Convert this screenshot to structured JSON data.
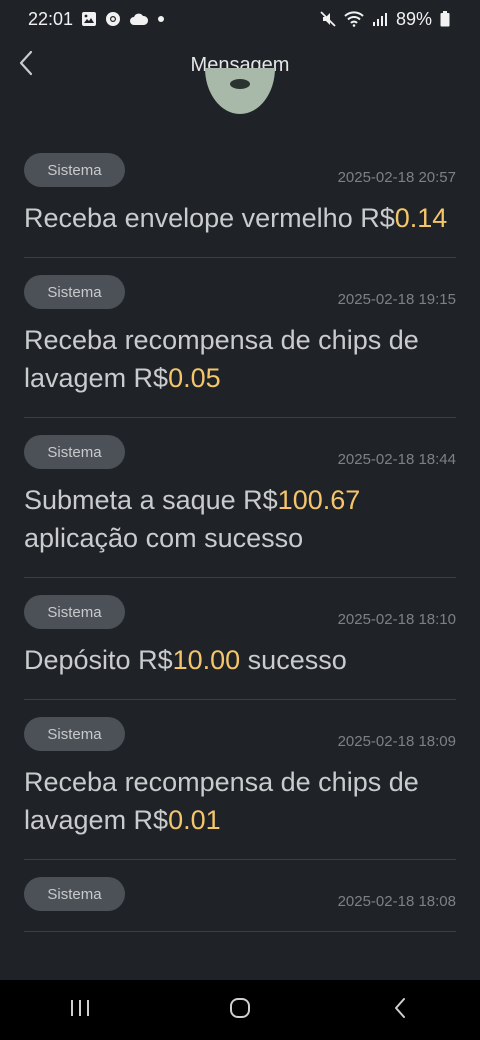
{
  "status_bar": {
    "time": "22:01",
    "battery": "89%"
  },
  "header": {
    "title": "Mensagem"
  },
  "messages": [
    {
      "badge": "Sistema",
      "time": "2025-02-18 20:57",
      "before": "Receba envelope vermelho R$",
      "amount": "0.14",
      "after": ""
    },
    {
      "badge": "Sistema",
      "time": "2025-02-18 19:15",
      "before": "Receba recompensa de chips de lavagem R$",
      "amount": "0.05",
      "after": ""
    },
    {
      "badge": "Sistema",
      "time": "2025-02-18 18:44",
      "before": "Submeta a saque R$",
      "amount": "100.67",
      "after": " aplicação com sucesso"
    },
    {
      "badge": "Sistema",
      "time": "2025-02-18 18:10",
      "before": "Depósito R$",
      "amount": "10.00",
      "after": " sucesso"
    },
    {
      "badge": "Sistema",
      "time": "2025-02-18 18:09",
      "before": "Receba recompensa de chips de lavagem R$",
      "amount": "0.01",
      "after": ""
    },
    {
      "badge": "Sistema",
      "time": "2025-02-18 18:08",
      "before": "",
      "amount": "",
      "after": ""
    }
  ],
  "colors": {
    "background": "#1f2327",
    "amount": "#f4c56b",
    "badge_bg": "#4b5157"
  },
  "icons": {
    "back": "chevron-left-icon",
    "nav_recents": "recents-icon",
    "nav_home": "home-icon",
    "nav_back": "back-icon"
  }
}
